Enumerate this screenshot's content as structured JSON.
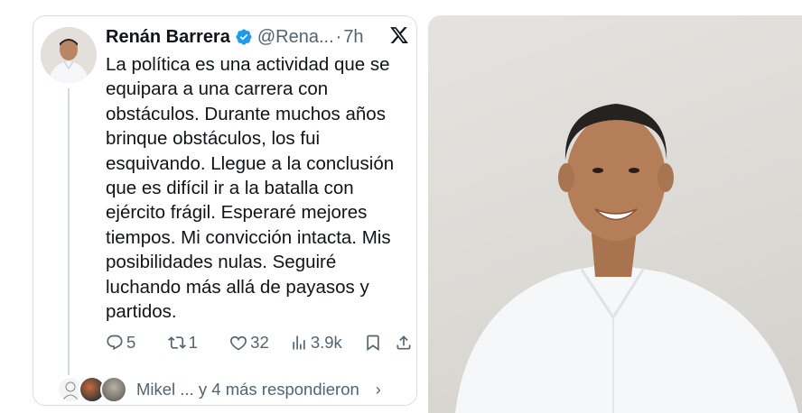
{
  "tweet": {
    "author_name": "Renán Barrera",
    "handle": "@Rena...",
    "separator": "·",
    "time": "7h",
    "text": "La política es una actividad que se equipara a una carrera con obstáculos. Durante muchos años brinque obstáculos, los fui esquivando. Llegue a la conclusión que es difícil ir a la batalla con ejército frágil. Esperaré mejores tiempos. Mi convicción intacta. Mis posibilidades nulas. Seguiré luchando más allá de payasos y partidos.",
    "verified_badge_color": "#1d9bf0",
    "actions": {
      "replies": "5",
      "retweets": "1",
      "likes": "32",
      "views": "3.9k"
    },
    "replied_by": "Mikel ... y 4 más respondieron",
    "chevron": "›"
  },
  "icons": [
    "verified-badge-icon",
    "x-logo-icon",
    "reply-icon",
    "retweet-icon",
    "like-icon",
    "views-icon",
    "bookmark-icon",
    "share-icon",
    "chevron-right-icon"
  ],
  "colors": {
    "text": "#0f1419",
    "secondary": "#536471",
    "border": "#d9dde2",
    "accent": "#1d9bf0"
  }
}
